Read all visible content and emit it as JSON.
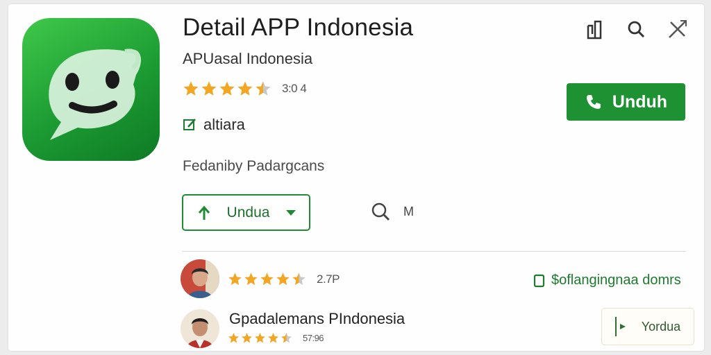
{
  "app": {
    "title": "Detail APP Indonesia",
    "subtitle": "APUasal Indonesia",
    "rating_value": 4.5,
    "rating_text": "3:0 4",
    "verified_label": "altiara",
    "developer_label": "Fedaniby Padargcans"
  },
  "actions": {
    "primary_label": "Unduh",
    "outline_label": "Undua",
    "mini_label": "M",
    "link_label": "$oflangingnaa domrs",
    "small_button_label": "Yorduа"
  },
  "reviews": [
    {
      "rating_value": 4.5,
      "rating_text": "2.7P"
    },
    {
      "name": "Gpadalemans PIndonesia",
      "rating_value": 4.5,
      "rating_text": "57:96"
    }
  ],
  "colors": {
    "accent": "#1e9132",
    "star": "#f2a623",
    "star_empty": "#c8c8c8",
    "link": "#1d7a2e"
  },
  "icons": [
    "bookmark-icon",
    "search-icon",
    "close-icon",
    "phone-icon",
    "download-arrow-icon",
    "chevron-down-icon",
    "search-icon",
    "checkbox-icon",
    "edit-icon"
  ]
}
